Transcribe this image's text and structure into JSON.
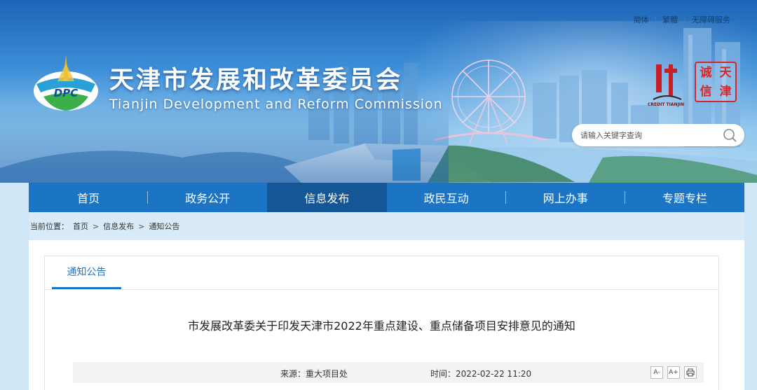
{
  "header": {
    "links": {
      "simplified": "简体",
      "traditional": "繁體",
      "accessibility": "无障碍服务"
    },
    "title": "天津市发展和改革委员会",
    "subtitle": "Tianjin Development and Reform Commission",
    "logo_text": "DPC",
    "credit_label": "CREDIT TIANJIN",
    "seal_chars": [
      "诚",
      "天",
      "信",
      "津"
    ]
  },
  "search": {
    "placeholder": "请输入关键字查询",
    "icon": "search-icon"
  },
  "nav": {
    "items": [
      "首页",
      "政务公开",
      "信息发布",
      "政民互动",
      "网上办事",
      "专题专栏"
    ],
    "active_index": 2
  },
  "breadcrumb": {
    "prefix": "当前位置：",
    "items": [
      "首页",
      "信息发布",
      "通知公告"
    ],
    "separator": ">"
  },
  "content": {
    "tab": "通知公告",
    "article_title": "市发展改革委关于印发天津市2022年重点建设、重点储备项目安排意见的通知",
    "source": "来源：重大项目处",
    "time": "时间：2022-02-22 11:20",
    "font_decrease": "A-",
    "font_increase": "A+",
    "print_icon": "printer-icon"
  },
  "colors": {
    "nav": "#1b75c4",
    "nav_active": "#155796",
    "accent": "#1b75c4",
    "seal": "#d6262c"
  }
}
